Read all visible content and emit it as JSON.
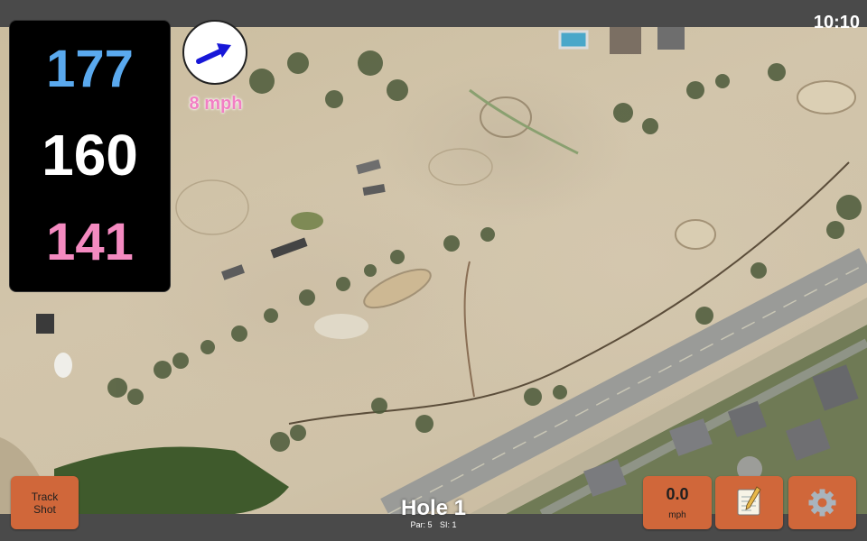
{
  "status": {
    "time": "10:10"
  },
  "yardage": {
    "back": "177",
    "middle": "160",
    "front": "141"
  },
  "wind": {
    "speed": "8 mph",
    "direction_icon": "wind-arrow-icon"
  },
  "hole": {
    "title": "Hole 1",
    "par": "Par: 5",
    "si": "SI: 1"
  },
  "buttons": {
    "track_shot_line1": "Track",
    "track_shot_line2": "Shot",
    "speed_value": "0.0",
    "speed_unit": "mph",
    "notes_icon": "notepad-icon",
    "settings_icon": "gear-icon"
  },
  "colors": {
    "back": "#5aa9ee",
    "middle": "#ffffff",
    "front": "#f48ac0",
    "button": "#d0673a",
    "wind_speed": "#f27fc4"
  }
}
